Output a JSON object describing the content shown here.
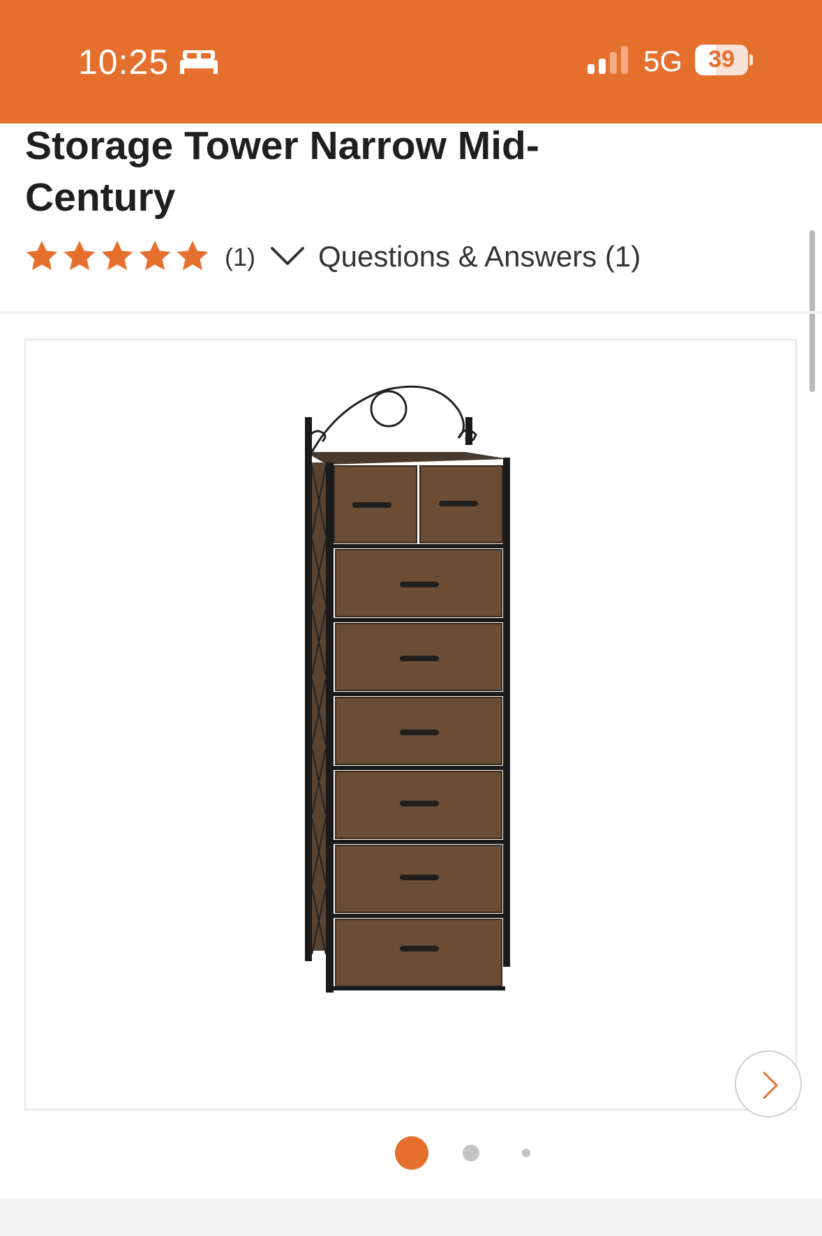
{
  "status_bar": {
    "time": "10:25",
    "network": "5G",
    "battery": "39",
    "background_color": "#e5702e"
  },
  "product": {
    "title": "Storage Tower Narrow Mid-Century",
    "rating": 5,
    "rating_count": "(1)",
    "qa_label": "Questions & Answers (1)"
  },
  "gallery": {
    "image_alt": "Black metal storage tower with eight brown fabric drawers and scrolled top rail",
    "total_images": 3,
    "active_index": 0
  },
  "theme": {
    "accent": "#e5702e",
    "star_color": "#e5702e"
  },
  "icons": {
    "sleep": "bed-icon",
    "signal": "signal-icon",
    "expand": "chevron-down-icon",
    "next": "chevron-right-icon"
  }
}
